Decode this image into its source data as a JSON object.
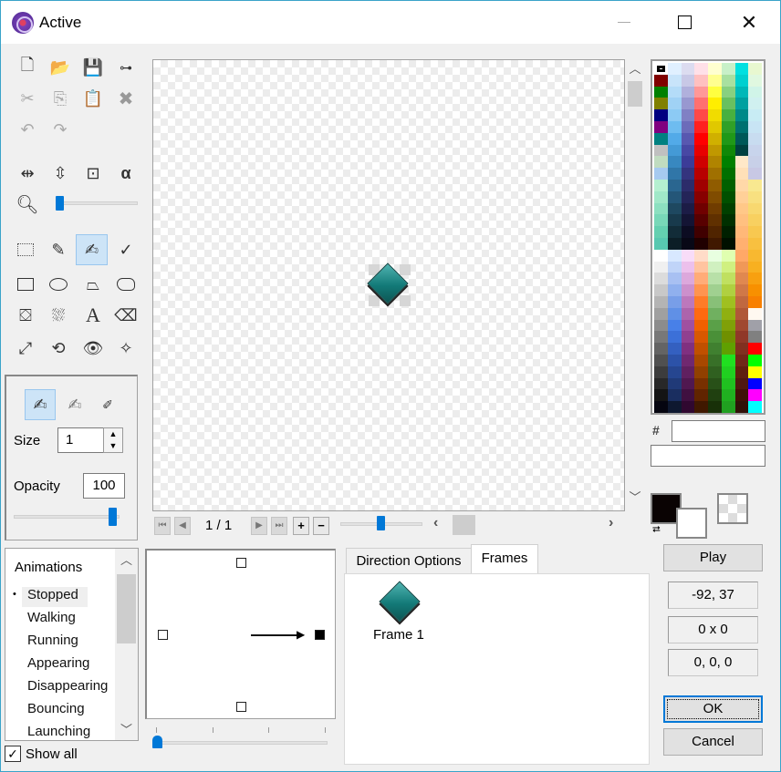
{
  "window": {
    "title": "Active",
    "controls": [
      "minimize",
      "maximize",
      "close"
    ]
  },
  "toolbar": {
    "rows": [
      [
        {
          "icon": "new-file-icon",
          "enabled": true
        },
        {
          "icon": "open-folder-icon",
          "enabled": true
        },
        {
          "icon": "save-icon",
          "enabled": true
        },
        {
          "icon": "bone-icon",
          "enabled": true
        }
      ],
      [
        {
          "icon": "cut-icon",
          "enabled": false
        },
        {
          "icon": "copy-icon",
          "enabled": false
        },
        {
          "icon": "paste-icon",
          "enabled": true
        },
        {
          "icon": "delete-icon",
          "enabled": false
        }
      ],
      [
        {
          "icon": "undo-icon",
          "enabled": false
        },
        {
          "icon": "redo-icon",
          "enabled": false
        }
      ],
      [
        {
          "icon": "flip-horizontal-icon",
          "enabled": true
        },
        {
          "icon": "flip-vertical-icon",
          "enabled": true
        },
        {
          "icon": "resize-icon",
          "enabled": true
        },
        {
          "icon": "alpha-icon",
          "enabled": true
        }
      ]
    ],
    "zoom_icon": "magnifier-icon",
    "zoom_level": 0.03,
    "tools": [
      {
        "icon": "rect-select-icon",
        "selected": false
      },
      {
        "icon": "color-picker-icon",
        "selected": false
      },
      {
        "icon": "freehand-icon",
        "selected": true
      },
      {
        "icon": "line-icon",
        "selected": false
      },
      {
        "icon": "rectangle-icon",
        "selected": false
      },
      {
        "icon": "ellipse-icon",
        "selected": false
      },
      {
        "icon": "polygon-icon",
        "selected": false
      },
      {
        "icon": "shape-icon",
        "selected": false
      },
      {
        "icon": "fill-icon",
        "selected": false
      },
      {
        "icon": "spray-icon",
        "selected": false
      },
      {
        "icon": "text-icon",
        "selected": false
      },
      {
        "icon": "eraser-icon",
        "selected": false
      },
      {
        "icon": "hotspot-resize-icon",
        "selected": false
      },
      {
        "icon": "rotate-icon",
        "selected": false
      },
      {
        "icon": "view-icon",
        "selected": false
      },
      {
        "icon": "action-point-icon",
        "selected": false
      }
    ]
  },
  "brush": {
    "modes": [
      {
        "icon": "brush-solid-icon",
        "selected": true
      },
      {
        "icon": "brush-dotted-icon",
        "selected": false
      },
      {
        "icon": "brush-point-icon",
        "selected": false
      }
    ],
    "size_label": "Size",
    "size_value": "1",
    "opacity_label": "Opacity",
    "opacity_value": "100",
    "opacity_slider": 100
  },
  "frame_nav": {
    "counter": "1 / 1",
    "add": "+",
    "remove": "−",
    "zoom_slider": 0.5
  },
  "animations": {
    "header": "Animations",
    "items": [
      "Stopped",
      "Walking",
      "Running",
      "Appearing",
      "Disappearing",
      "Bouncing",
      "Launching"
    ],
    "selected": "Stopped",
    "show_all_label": "Show all",
    "show_all_checked": true
  },
  "direction": {
    "speed_slider": 0
  },
  "tabs": [
    {
      "label": "Direction Options",
      "active": false
    },
    {
      "label": "Frames",
      "active": true
    }
  ],
  "frames": [
    {
      "label": "Frame 1"
    }
  ],
  "palette": {
    "hash_label": "#",
    "hex_value": "",
    "name_value": ""
  },
  "colors": {
    "foreground": "#0a0303",
    "background": "#ffffff"
  },
  "side": {
    "play": "Play",
    "coords": "-92, 37",
    "size": "0 x 0",
    "rgb": "0, 0, 0",
    "ok": "OK",
    "cancel": "Cancel"
  }
}
